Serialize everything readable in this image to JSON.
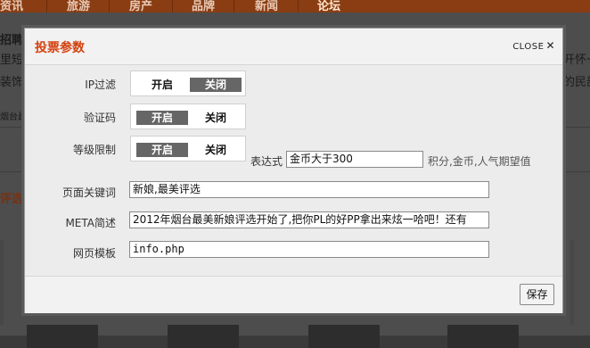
{
  "background": {
    "nav_items": [
      "资讯",
      "旅游",
      "房产",
      "品牌",
      "新闻",
      "论坛"
    ],
    "snippets": [
      "招聘",
      "里短",
      "装饰",
      "烟台最",
      "评选",
      "开怀一",
      "的民部"
    ]
  },
  "dialog": {
    "title": "投票参数",
    "close_label": "CLOSE",
    "close_icon": "✕",
    "fields": {
      "ip_filter": {
        "label": "IP过滤",
        "on": "开启",
        "off": "关闭",
        "state": "off"
      },
      "captcha": {
        "label": "验证码",
        "on": "开启",
        "off": "关闭",
        "state": "on"
      },
      "level_limit": {
        "label": "等级限制",
        "on": "开启",
        "off": "关闭",
        "state": "on",
        "expr_label": "表达式",
        "expr_value": "金币大于300",
        "expr_hint": "积分,金币,人气期望值"
      },
      "keywords": {
        "label": "页面关键词",
        "value": "新娘,最美评选"
      },
      "meta": {
        "label": "META简述",
        "value": "2012年烟台最美新娘评选开始了,把你PL的好PP拿出来炫一哈吧！还有"
      },
      "template": {
        "label": "网页模板",
        "value": "info.php"
      }
    },
    "save_label": "保存"
  }
}
